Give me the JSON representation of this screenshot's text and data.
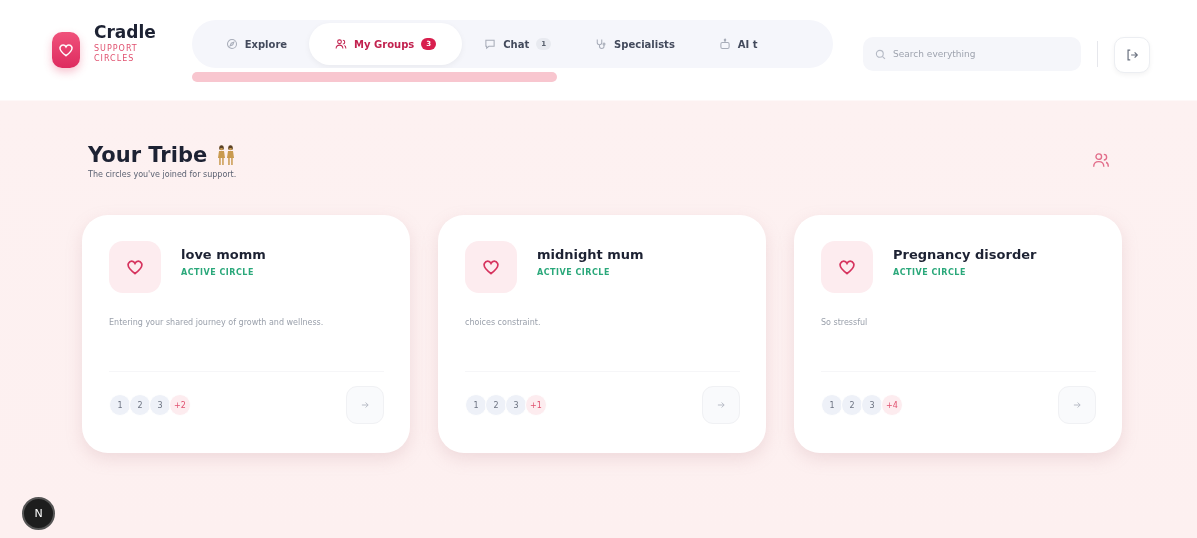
{
  "brand": {
    "name": "Cradle",
    "tagline": "SUPPORT CIRCLES"
  },
  "nav": [
    {
      "label": "Explore",
      "selected": false
    },
    {
      "label": "My Groups",
      "selected": true,
      "badge": "3"
    },
    {
      "label": "Chat",
      "selected": false,
      "badge": "1"
    },
    {
      "label": "Specialists",
      "selected": false
    },
    {
      "label": "AI t",
      "selected": false
    }
  ],
  "search": {
    "placeholder": "Search everything"
  },
  "page": {
    "title": "Your Tribe",
    "subtitle": "The circles you've joined for support."
  },
  "groups": [
    {
      "name": "love momm",
      "status": "ACTIVE CIRCLE",
      "description": "Entering your shared journey of growth and wellness.",
      "members": [
        "1",
        "2",
        "3"
      ],
      "extra": "+2"
    },
    {
      "name": "midnight mum",
      "status": "ACTIVE CIRCLE",
      "description": "choices constraint.",
      "members": [
        "1",
        "2",
        "3"
      ],
      "extra": "+1"
    },
    {
      "name": "Pregnancy disorder",
      "status": "ACTIVE CIRCLE",
      "description": "So stressful",
      "members": [
        "1",
        "2",
        "3"
      ],
      "extra": "+4"
    }
  ],
  "dev_badge": "N"
}
